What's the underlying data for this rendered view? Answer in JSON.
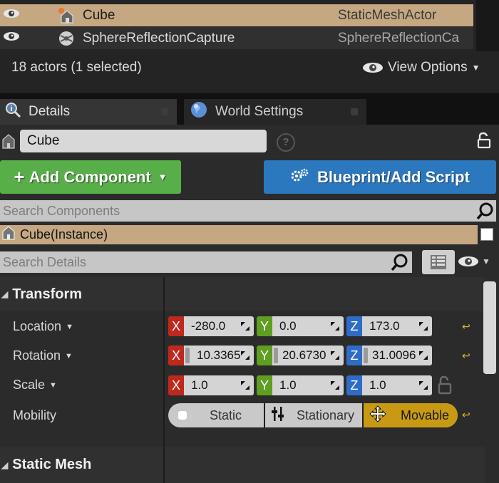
{
  "outliner": {
    "rows": [
      {
        "name": "Cube",
        "type": "StaticMeshActor",
        "selected": true
      },
      {
        "name": "SphereReflectionCapture",
        "type": "SphereReflectionCa",
        "selected": false
      }
    ],
    "actor_count": "18 actors (1 selected)",
    "view_options": "View Options"
  },
  "tabs": [
    {
      "label": "Details",
      "icon": "magnifier-icon",
      "active": true
    },
    {
      "label": "World Settings",
      "icon": "globe-icon",
      "active": false
    }
  ],
  "details": {
    "actor_name": "Cube",
    "add_component": "Add Component",
    "blueprint": "Blueprint/Add Script",
    "search_components_placeholder": "Search Components",
    "component_instance": "Cube(Instance)",
    "search_details_placeholder": "Search Details"
  },
  "transform": {
    "title": "Transform",
    "location_label": "Location",
    "rotation_label": "Rotation",
    "scale_label": "Scale",
    "mobility_label": "Mobility",
    "location": {
      "x": "-280.0",
      "y": "0.0",
      "z": "173.0"
    },
    "rotation": {
      "x": "10.3365",
      "y": "20.6730",
      "z": "31.0096"
    },
    "scale": {
      "x": "1.0",
      "y": "1.0",
      "z": "1.0"
    },
    "mobility": {
      "static": "Static",
      "stationary": "Stationary",
      "movable": "Movable",
      "selected": "Movable"
    }
  },
  "static_mesh": {
    "title": "Static Mesh"
  },
  "colors": {
    "selection": "#c5a881",
    "add_green": "#58ae49",
    "blueprint_blue": "#2c78be",
    "movable_gold": "#c89a14"
  }
}
